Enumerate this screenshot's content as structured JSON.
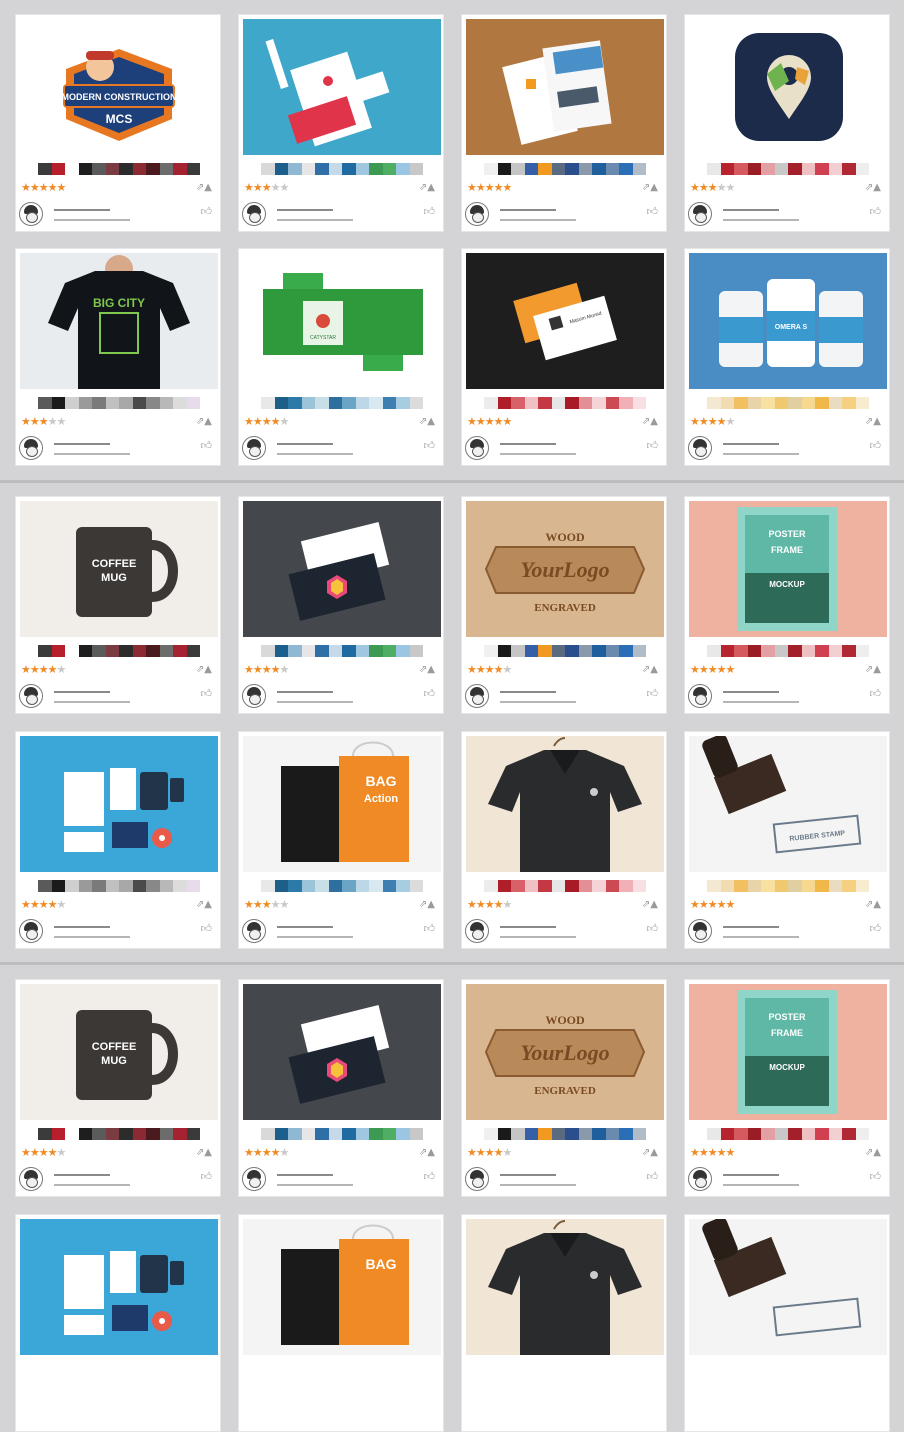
{
  "gallery": {
    "cards": [
      {
        "thumb": "mascot-logo",
        "rating": 5,
        "palette": [
          "#3b3b3b",
          "#b81f2c",
          "#ffffff",
          "#1e1e1e",
          "#5b5b5b",
          "#7b3c41",
          "#2c2c2c",
          "#8c2a33",
          "#4a1a1e",
          "#6c6c6c",
          "#a52230",
          "#3a3a3a"
        ],
        "logo_title": "MODERN CONSTRUCTION",
        "logo_badge": "MCS"
      },
      {
        "thumb": "stationery-red",
        "rating": 3,
        "palette": [
          "#d9d9d9",
          "#1c5f8c",
          "#8fb8d4",
          "#e6e6e6",
          "#2e6fa8",
          "#c6d9e8",
          "#1f6aa1",
          "#9fc7e0",
          "#3c9a53",
          "#4fae64",
          "#9bc6e3",
          "#c8c8c8"
        ]
      },
      {
        "thumb": "flyer-wood",
        "rating": 5,
        "palette": [
          "#f0f0f0",
          "#1a1a1a",
          "#c5c5c5",
          "#3560a8",
          "#f29a1f",
          "#5a6a80",
          "#2a4f8c",
          "#8a9aaa",
          "#1e5f9c",
          "#6a8ab0",
          "#2a6fb5",
          "#b0bcc8"
        ]
      },
      {
        "thumb": "map-app-icon",
        "rating": 3,
        "palette": [
          "#e8e8e8",
          "#b8242e",
          "#d45a60",
          "#9a1c24",
          "#e2a0a4",
          "#c8c8c8",
          "#a3202a",
          "#efc0c2",
          "#d04050",
          "#f2d0d2",
          "#b02834",
          "#eeeeee"
        ]
      },
      {
        "thumb": "tshirt-bigcity",
        "rating": 3,
        "palette": [
          "#5a5a5a",
          "#1a1a1a",
          "#cfcfcf",
          "#9a9a9a",
          "#7a7a7a",
          "#c0c0c0",
          "#a8a8a8",
          "#4a4a4a",
          "#888888",
          "#b8b8b8",
          "#dcdcdc",
          "#e8dcec"
        ],
        "shirt_text": "BIG CITY"
      },
      {
        "thumb": "green-box",
        "rating": 4,
        "palette": [
          "#e8e8e8",
          "#1d5f88",
          "#2b7aa8",
          "#9bc4d8",
          "#c8dfe8",
          "#2e6fa0",
          "#6aa5c5",
          "#bcd8e6",
          "#d8e8f0",
          "#3c7fb0",
          "#a6cde2",
          "#dcdcdc"
        ],
        "box_label": "CATYSTAR"
      },
      {
        "thumb": "orange-business-card",
        "rating": 5,
        "palette": [
          "#ececec",
          "#b01e2a",
          "#d86068",
          "#f0c0c4",
          "#c43844",
          "#e6e6e6",
          "#a81a26",
          "#e29096",
          "#f4d4d6",
          "#cc4a54",
          "#f0b0b6",
          "#f8e0e2"
        ],
        "card_name": "Masum Mursid"
      },
      {
        "thumb": "supplement-bottles",
        "rating": 4,
        "palette": [
          "#f4e8d0",
          "#f0dcb0",
          "#f2c060",
          "#e8d4a8",
          "#f8e0a0",
          "#f0c870",
          "#e0cfa0",
          "#f6d890",
          "#f0b848",
          "#eadcc0",
          "#f4d080",
          "#f8ecd0"
        ],
        "bottle_label": "OMERA S"
      },
      {
        "thumb": "coffee-mug",
        "rating": 4,
        "palette": [
          "#3b3b3b",
          "#b81f2c",
          "#ffffff",
          "#1e1e1e",
          "#5b5b5b",
          "#7b3c41",
          "#2c2c2c",
          "#8c2a33",
          "#4a1a1e",
          "#6c6c6c",
          "#a52230",
          "#3a3a3a"
        ],
        "mug_line1": "COFFEE",
        "mug_line2": "MUG"
      },
      {
        "thumb": "business-cards-dark",
        "rating": 4,
        "palette": [
          "#d9d9d9",
          "#1c5f8c",
          "#8fb8d4",
          "#e6e6e6",
          "#2e6fa8",
          "#c6d9e8",
          "#1f6aa1",
          "#9fc7e0",
          "#3c9a53",
          "#4fae64",
          "#9bc6e3",
          "#c8c8c8"
        ]
      },
      {
        "thumb": "wood-logo",
        "rating": 4,
        "palette": [
          "#f0f0f0",
          "#1a1a1a",
          "#c5c5c5",
          "#3560a8",
          "#f29a1f",
          "#5a6a80",
          "#2a4f8c",
          "#8a9aaa",
          "#1e5f9c",
          "#6a8ab0",
          "#2a6fb5",
          "#b0bcc8"
        ],
        "wood_top": "WOOD",
        "wood_mid": "YourLogo",
        "wood_bottom": "ENGRAVED"
      },
      {
        "thumb": "poster-frame",
        "rating": 5,
        "palette": [
          "#e8e8e8",
          "#b8242e",
          "#d45a60",
          "#9a1c24",
          "#e2a0a4",
          "#c8c8c8",
          "#a3202a",
          "#efc0c2",
          "#d04050",
          "#f2d0d2",
          "#b02834",
          "#eeeeee"
        ],
        "poster_l1": "POSTER",
        "poster_l2": "FRAME",
        "poster_l3": "MOCKUP"
      },
      {
        "thumb": "stationery-blue",
        "rating": 4,
        "palette": [
          "#5a5a5a",
          "#1a1a1a",
          "#cfcfcf",
          "#9a9a9a",
          "#7a7a7a",
          "#c0c0c0",
          "#a8a8a8",
          "#4a4a4a",
          "#888888",
          "#b8b8b8",
          "#dcdcdc",
          "#e8dcec"
        ]
      },
      {
        "thumb": "shopping-bags",
        "rating": 3,
        "palette": [
          "#e8e8e8",
          "#1d5f88",
          "#2b7aa8",
          "#9bc4d8",
          "#c8dfe8",
          "#2e6fa0",
          "#6aa5c5",
          "#bcd8e6",
          "#d8e8f0",
          "#3c7fb0",
          "#a6cde2",
          "#dcdcdc"
        ],
        "bag_l1": "BAG",
        "bag_l2": "Action"
      },
      {
        "thumb": "polo-shirt",
        "rating": 4,
        "palette": [
          "#ececec",
          "#b01e2a",
          "#d86068",
          "#f0c0c4",
          "#c43844",
          "#e6e6e6",
          "#a81a26",
          "#e29096",
          "#f4d4d6",
          "#cc4a54",
          "#f0b0b6",
          "#f8e0e2"
        ]
      },
      {
        "thumb": "rubber-stamp",
        "rating": 5,
        "palette": [
          "#f4e8d0",
          "#f0dcb0",
          "#f2c060",
          "#e8d4a8",
          "#f8e0a0",
          "#f0c870",
          "#e0cfa0",
          "#f6d890",
          "#f0b848",
          "#eadcc0",
          "#f4d080",
          "#f8ecd0"
        ],
        "stamp_text": "RUBBER STAMP"
      },
      {
        "thumb": "coffee-mug",
        "rating": 4,
        "palette": [
          "#3b3b3b",
          "#b81f2c",
          "#ffffff",
          "#1e1e1e",
          "#5b5b5b",
          "#7b3c41",
          "#2c2c2c",
          "#8c2a33",
          "#4a1a1e",
          "#6c6c6c",
          "#a52230",
          "#3a3a3a"
        ],
        "mug_line1": "COFFEE",
        "mug_line2": "MUG"
      },
      {
        "thumb": "business-cards-dark",
        "rating": 4,
        "palette": [
          "#d9d9d9",
          "#1c5f8c",
          "#8fb8d4",
          "#e6e6e6",
          "#2e6fa8",
          "#c6d9e8",
          "#1f6aa1",
          "#9fc7e0",
          "#3c9a53",
          "#4fae64",
          "#9bc6e3",
          "#c8c8c8"
        ]
      },
      {
        "thumb": "wood-logo",
        "rating": 4,
        "palette": [
          "#f0f0f0",
          "#1a1a1a",
          "#c5c5c5",
          "#3560a8",
          "#f29a1f",
          "#5a6a80",
          "#2a4f8c",
          "#8a9aaa",
          "#1e5f9c",
          "#6a8ab0",
          "#2a6fb5",
          "#b0bcc8"
        ],
        "wood_top": "WOOD",
        "wood_mid": "YourLogo",
        "wood_bottom": "ENGRAVED"
      },
      {
        "thumb": "poster-frame",
        "rating": 5,
        "palette": [
          "#e8e8e8",
          "#b8242e",
          "#d45a60",
          "#9a1c24",
          "#e2a0a4",
          "#c8c8c8",
          "#a3202a",
          "#efc0c2",
          "#d04050",
          "#f2d0d2",
          "#b02834",
          "#eeeeee"
        ],
        "poster_l1": "POSTER",
        "poster_l2": "FRAME",
        "poster_l3": "MOCKUP"
      },
      {
        "thumb": "stationery-blue",
        "rating": 0,
        "palette": []
      },
      {
        "thumb": "shopping-bags",
        "rating": 0,
        "palette": [],
        "bag_l1": "BAG",
        "bag_l2": ""
      },
      {
        "thumb": "polo-shirt",
        "rating": 0,
        "palette": []
      },
      {
        "thumb": "rubber-stamp",
        "rating": 0,
        "palette": [],
        "stamp_text": ""
      }
    ]
  },
  "icons": {
    "share": "share-icon",
    "report": "report-icon",
    "like": "thumbs-up-icon",
    "avatar": "user-avatar"
  },
  "colors": {
    "star": "#f08a24",
    "background": "#d4d4d6"
  }
}
